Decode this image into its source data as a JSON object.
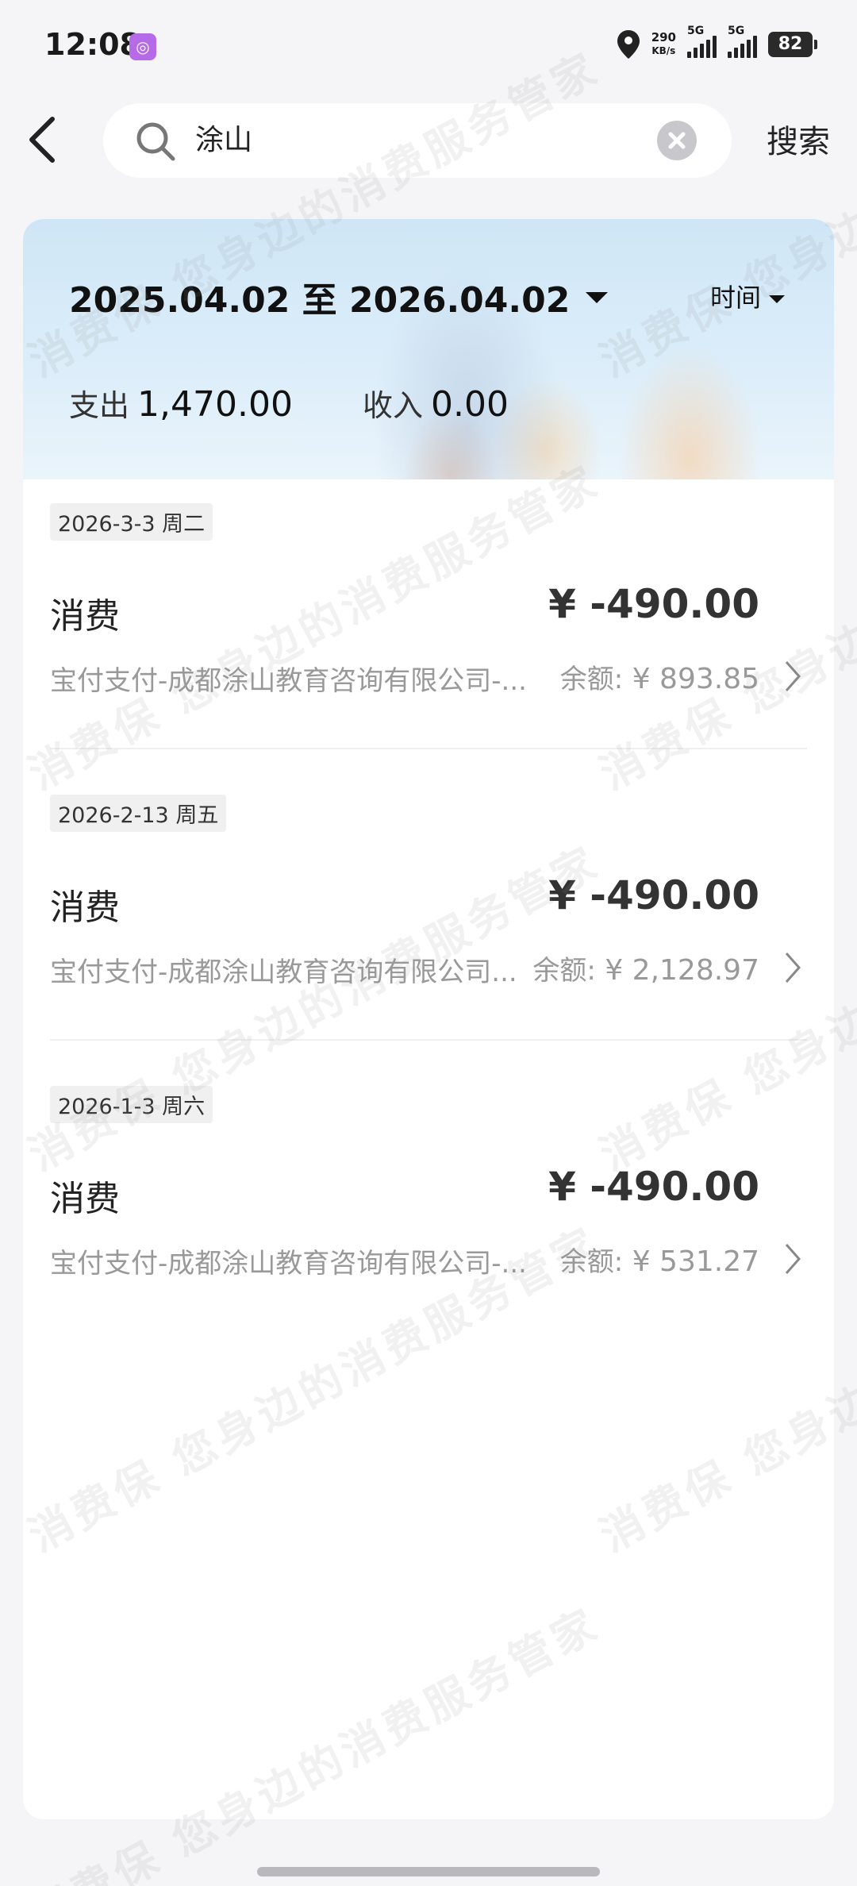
{
  "status_bar": {
    "time": "12:08",
    "net_speed_value": "290",
    "net_speed_unit": "KB/s",
    "sim1_label": "5G",
    "sim2_label": "5G",
    "battery": "82",
    "icons": [
      "app-notification-icon",
      "location-icon",
      "signal-icon",
      "battery-icon"
    ]
  },
  "search": {
    "query": "涂山",
    "button_label": "搜索",
    "icons": [
      "back-arrow-icon",
      "search-icon",
      "clear-icon"
    ]
  },
  "summary": {
    "date_range": "2025.04.02 至 2026.04.02",
    "sort_label": "时间",
    "expense_label": "支出",
    "expense_value": "1,470.00",
    "income_label": "收入",
    "income_value": "0.00"
  },
  "transactions": [
    {
      "date": "2026-3-3 周二",
      "title": "消费",
      "amount": "¥ -490.00",
      "description": "宝付支付-成都涂山教育咨询有限公司-...",
      "balance_label": "余额:",
      "balance_value": "¥ 893.85"
    },
    {
      "date": "2026-2-13 周五",
      "title": "消费",
      "amount": "¥ -490.00",
      "description": "宝付支付-成都涂山教育咨询有限公司...",
      "balance_label": "余额:",
      "balance_value": "¥ 2,128.97"
    },
    {
      "date": "2026-1-3 周六",
      "title": "消费",
      "amount": "¥ -490.00",
      "description": "宝付支付-成都涂山教育咨询有限公司-...",
      "balance_label": "余额:",
      "balance_value": "¥ 531.27"
    }
  ],
  "watermark_text": "消费保 您身边的消费服务管家",
  "colors": {
    "page_bg": "#f5f5f7",
    "card_bg": "#ffffff",
    "banner_bg": "#d6eaf8",
    "muted_text": "#999999"
  }
}
